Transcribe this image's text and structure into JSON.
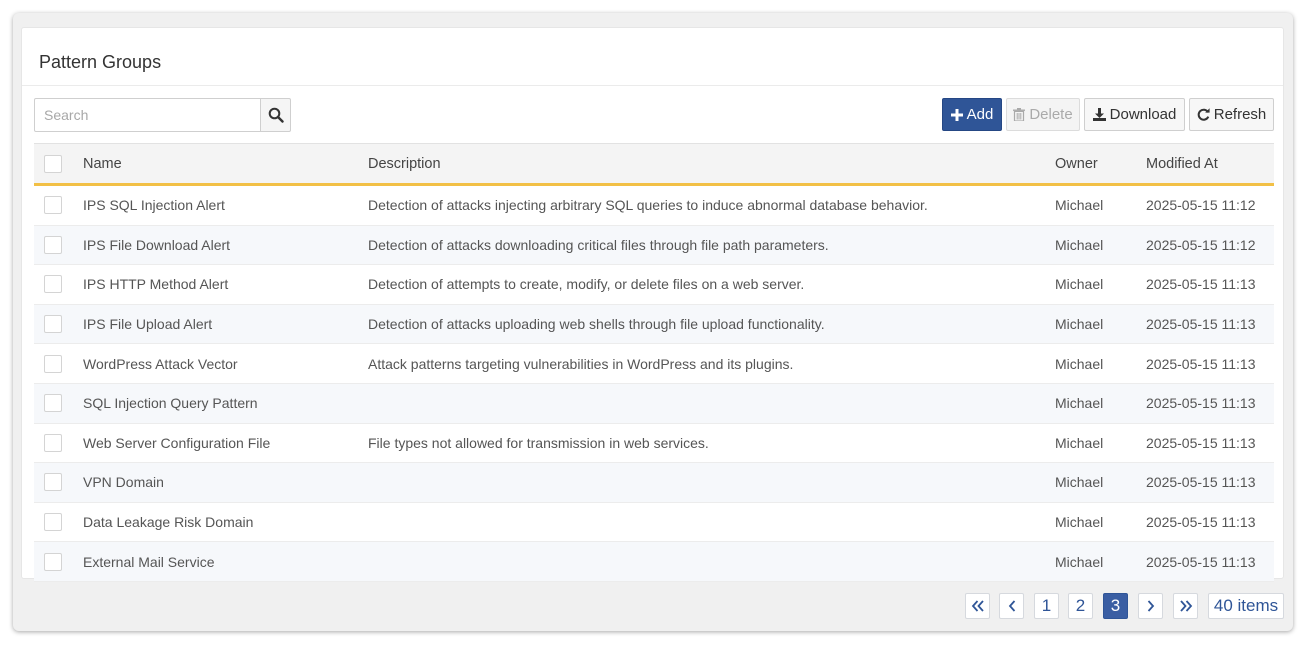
{
  "panel": {
    "title": "Pattern Groups"
  },
  "search": {
    "placeholder": "Search",
    "value": ""
  },
  "toolbar": {
    "add_label": "Add",
    "delete_label": "Delete",
    "download_label": "Download",
    "refresh_label": "Refresh"
  },
  "table": {
    "headers": {
      "name": "Name",
      "description": "Description",
      "owner": "Owner",
      "modified": "Modified At"
    },
    "rows": [
      {
        "name": "IPS SQL Injection Alert",
        "description": "Detection of attacks injecting arbitrary SQL queries to induce abnormal database behavior.",
        "owner": "Michael",
        "modified": "2025-05-15 11:12"
      },
      {
        "name": "IPS File Download Alert",
        "description": "Detection of attacks downloading critical files through file path parameters.",
        "owner": "Michael",
        "modified": "2025-05-15 11:12"
      },
      {
        "name": "IPS HTTP Method Alert",
        "description": "Detection of attempts to create, modify, or delete files on a web server.",
        "owner": "Michael",
        "modified": "2025-05-15 11:13"
      },
      {
        "name": "IPS File Upload Alert",
        "description": "Detection of attacks uploading web shells through file upload functionality.",
        "owner": "Michael",
        "modified": "2025-05-15 11:13"
      },
      {
        "name": "WordPress Attack Vector",
        "description": "Attack patterns targeting vulnerabilities in WordPress and its plugins.",
        "owner": "Michael",
        "modified": "2025-05-15 11:13"
      },
      {
        "name": "SQL Injection Query Pattern",
        "description": "",
        "owner": "Michael",
        "modified": "2025-05-15 11:13"
      },
      {
        "name": "Web Server Configuration File",
        "description": "File types not allowed for transmission in web services.",
        "owner": "Michael",
        "modified": "2025-05-15 11:13"
      },
      {
        "name": "VPN Domain",
        "description": "",
        "owner": "Michael",
        "modified": "2025-05-15 11:13"
      },
      {
        "name": "Data Leakage Risk Domain",
        "description": "",
        "owner": "Michael",
        "modified": "2025-05-15 11:13"
      },
      {
        "name": "External Mail Service",
        "description": "",
        "owner": "Michael",
        "modified": "2025-05-15 11:13"
      }
    ]
  },
  "pagination": {
    "pages": [
      "1",
      "2",
      "3"
    ],
    "current_page": "3",
    "total_label": "40 items"
  },
  "colors": {
    "primary": "#2f5597",
    "header_underline": "#f2c046"
  },
  "icons": {
    "search": "search-icon",
    "add": "plus-icon",
    "delete": "trash-icon",
    "download": "download-icon",
    "refresh": "refresh-icon",
    "first": "double-chevron-left-icon",
    "prev": "chevron-left-icon",
    "next": "chevron-right-icon",
    "last": "double-chevron-right-icon"
  }
}
